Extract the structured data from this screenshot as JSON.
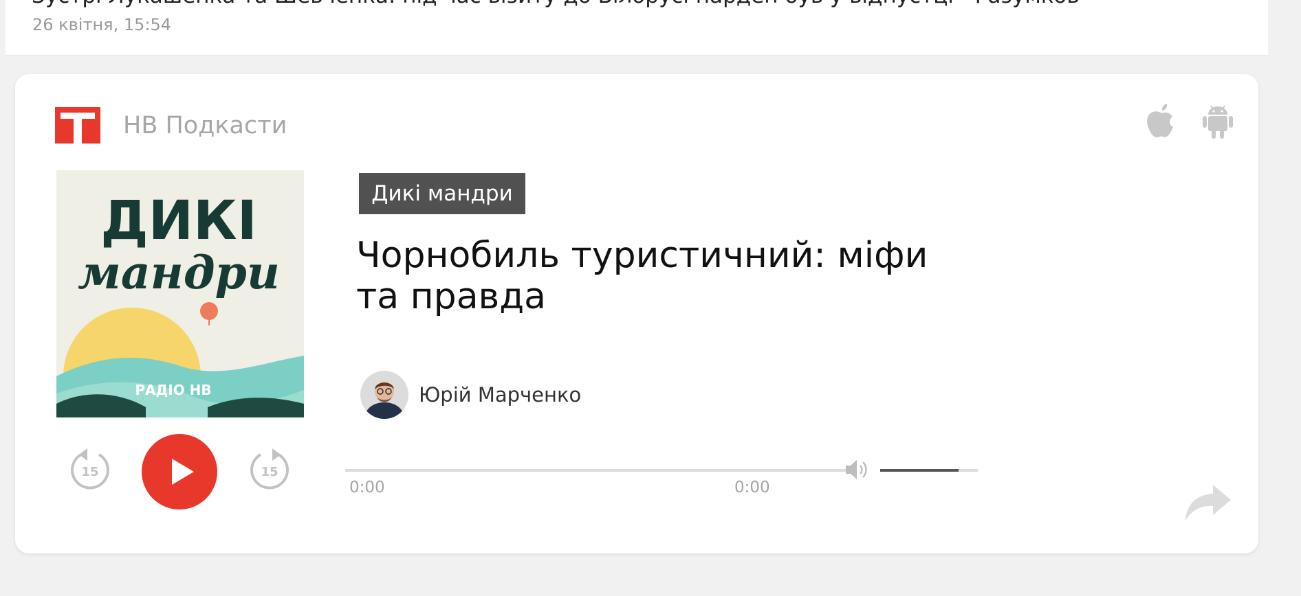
{
  "news": {
    "headline": "Зустрі Лукашенка та Шевченка: під час візиту до Білорусі нардеп був у відпустці - Разумков",
    "time": "26 квітня, 15:54"
  },
  "player": {
    "brand": "НВ Подкасти",
    "show_label": "Дикі мандри",
    "episode_title": "Чорнобиль туристичний: міфи та правда",
    "author_name": "Юрій Марченко",
    "current_time": "0:00",
    "duration": "0:00",
    "rewind_seconds": "15",
    "forward_seconds": "15",
    "progress_fraction": 0,
    "volume_fraction": 0.8,
    "cover_art": {
      "line1": "ДИКІ",
      "line2": "мандри",
      "station": "РАДІО НВ"
    }
  },
  "icons": {
    "logo": "hv-logo-icon",
    "apple": "apple-icon",
    "android": "android-icon",
    "rewind": "rewind-15-icon",
    "play": "play-icon",
    "forward": "forward-15-icon",
    "volume": "volume-icon",
    "share": "share-icon"
  },
  "colors": {
    "brand_red": "#e8372b",
    "badge_bg": "#515151",
    "muted_gray": "#a7a7a7"
  }
}
